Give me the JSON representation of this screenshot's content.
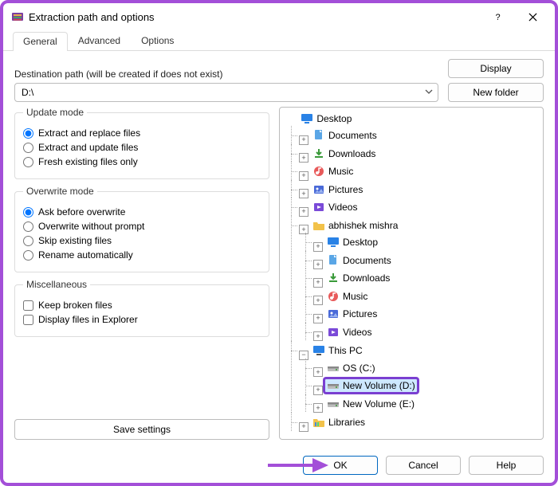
{
  "window": {
    "title": "Extraction path and options"
  },
  "tabs": {
    "general": "General",
    "advanced": "Advanced",
    "options": "Options"
  },
  "destination": {
    "label": "Destination path (will be created if does not exist)",
    "value": "D:\\"
  },
  "sideButtons": {
    "display": "Display",
    "newFolder": "New folder"
  },
  "updateMode": {
    "legend": "Update mode",
    "extract_replace": "Extract and replace files",
    "extract_update": "Extract and update files",
    "fresh": "Fresh existing files only"
  },
  "overwriteMode": {
    "legend": "Overwrite mode",
    "ask": "Ask before overwrite",
    "without": "Overwrite without prompt",
    "skip": "Skip existing files",
    "rename": "Rename automatically"
  },
  "misc": {
    "legend": "Miscellaneous",
    "keep_broken": "Keep broken files",
    "display_explorer": "Display files in Explorer"
  },
  "saveSettings": "Save settings",
  "tree": {
    "desktop": "Desktop",
    "documents": "Documents",
    "downloads": "Downloads",
    "music": "Music",
    "pictures": "Pictures",
    "videos": "Videos",
    "user_folder": "abhishek mishra",
    "this_pc": "This PC",
    "os_c": "OS (C:)",
    "new_vol_d": "New Volume (D:)",
    "new_vol_e": "New Volume (E:)",
    "libraries": "Libraries"
  },
  "buttons": {
    "ok": "OK",
    "cancel": "Cancel",
    "help": "Help"
  }
}
